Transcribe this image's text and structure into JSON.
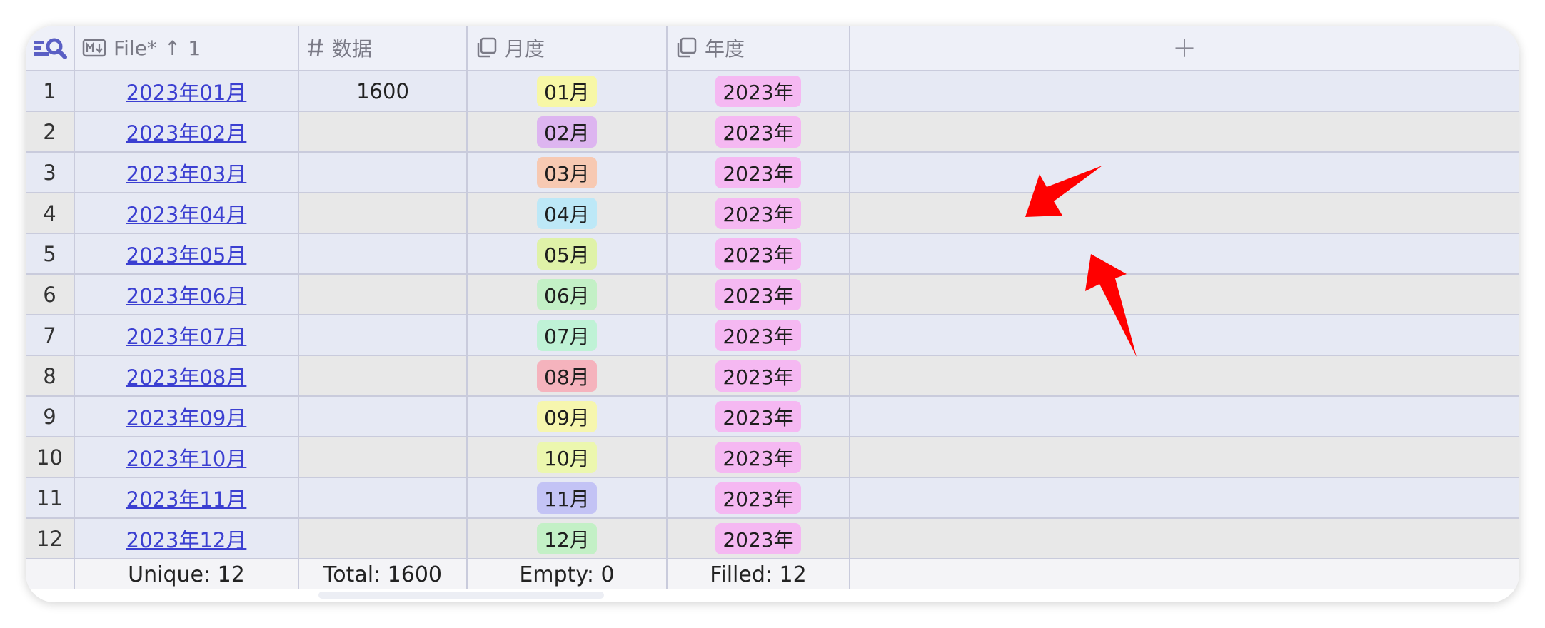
{
  "header": {
    "file_label": "File*",
    "sort_arrow": "↑",
    "sort_index": "1",
    "num_label": "数据",
    "month_label": "月度",
    "year_label": "年度",
    "add_label": "+"
  },
  "rows": [
    {
      "index": "1",
      "file": "2023年01月",
      "value": "1600",
      "month": "01月",
      "month_color": "#f7f7a6",
      "year": "2023年"
    },
    {
      "index": "2",
      "file": "2023年02月",
      "value": "",
      "month": "02月",
      "month_color": "#ddb5f0",
      "year": "2023年"
    },
    {
      "index": "3",
      "file": "2023年03月",
      "value": "",
      "month": "03月",
      "month_color": "#f7c9b2",
      "year": "2023年"
    },
    {
      "index": "4",
      "file": "2023年04月",
      "value": "",
      "month": "04月",
      "month_color": "#bde8f7",
      "year": "2023年"
    },
    {
      "index": "5",
      "file": "2023年05月",
      "value": "",
      "month": "05月",
      "month_color": "#dff2a8",
      "year": "2023年"
    },
    {
      "index": "6",
      "file": "2023年06月",
      "value": "",
      "month": "06月",
      "month_color": "#c3f0c6",
      "year": "2023年"
    },
    {
      "index": "7",
      "file": "2023年07月",
      "value": "",
      "month": "07月",
      "month_color": "#bff2d6",
      "year": "2023年"
    },
    {
      "index": "8",
      "file": "2023年08月",
      "value": "",
      "month": "08月",
      "month_color": "#f5b3bd",
      "year": "2023年"
    },
    {
      "index": "9",
      "file": "2023年09月",
      "value": "",
      "month": "09月",
      "month_color": "#f6f6ae",
      "year": "2023年"
    },
    {
      "index": "10",
      "file": "2023年10月",
      "value": "",
      "month": "10月",
      "month_color": "#ecf7ae",
      "year": "2023年"
    },
    {
      "index": "11",
      "file": "2023年11月",
      "value": "",
      "month": "11月",
      "month_color": "#c3c3f5",
      "year": "2023年"
    },
    {
      "index": "12",
      "file": "2023年12月",
      "value": "",
      "month": "12月",
      "month_color": "#c3f0c6",
      "year": "2023年"
    }
  ],
  "footer": {
    "file_stat": "Unique:  12",
    "num_stat": "Total:  1600",
    "month_stat": "Empty:  0",
    "year_stat": "Filled:  12"
  },
  "colors": {
    "year_tag": "#f5b8f2",
    "link": "#3b3fd1",
    "arrow": "#ff0000"
  },
  "icons": [
    "search-list-icon",
    "markdown-icon",
    "hash-icon",
    "copy-icon"
  ]
}
